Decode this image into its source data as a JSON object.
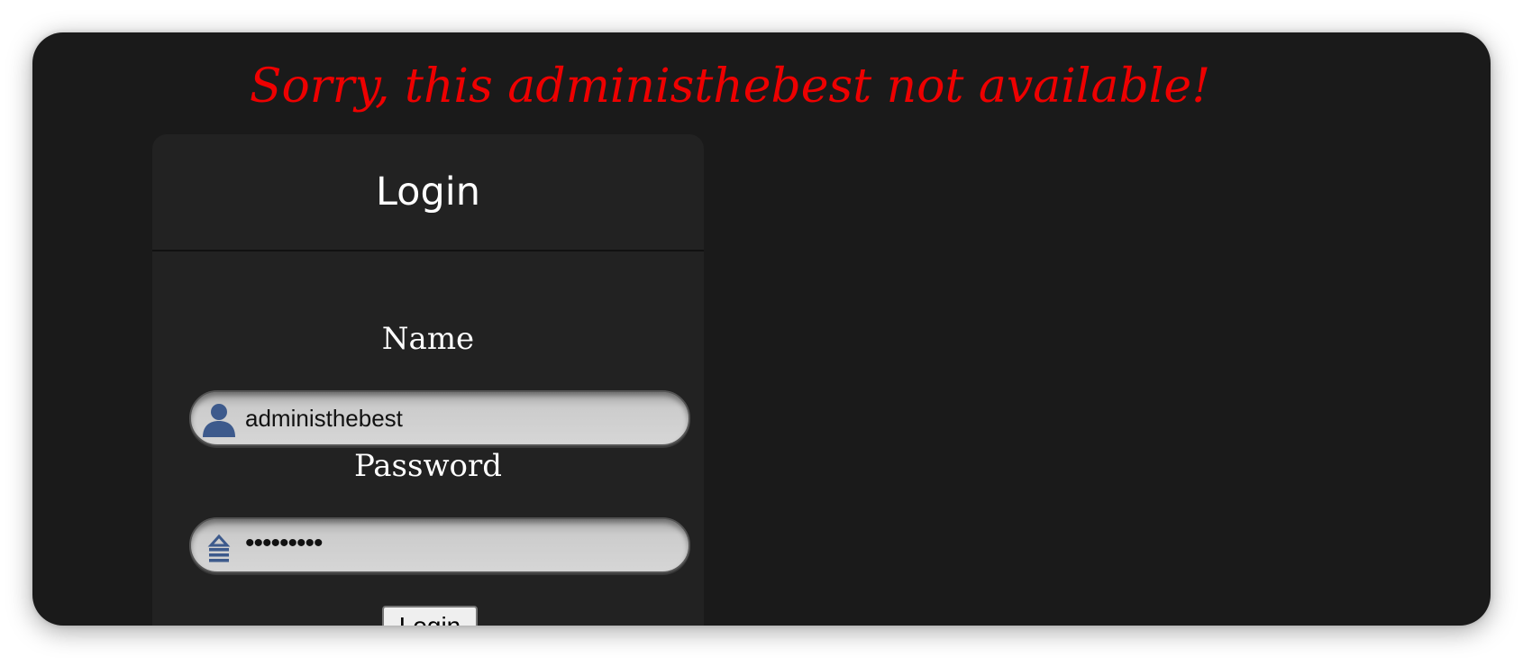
{
  "error_message": "Sorry, this administhebest not available!",
  "login_panel": {
    "title": "Login",
    "name_field": {
      "label": "Name",
      "value": "administhebest",
      "icon": "user-icon"
    },
    "password_field": {
      "label": "Password",
      "value": "•••••••••",
      "icon": "lock-icon"
    },
    "submit_label": "Login"
  },
  "colors": {
    "window_background": "#1a1a1a",
    "panel_background": "#222222",
    "error_text": "#ee0000",
    "icon_blue": "#3d5a8c"
  }
}
